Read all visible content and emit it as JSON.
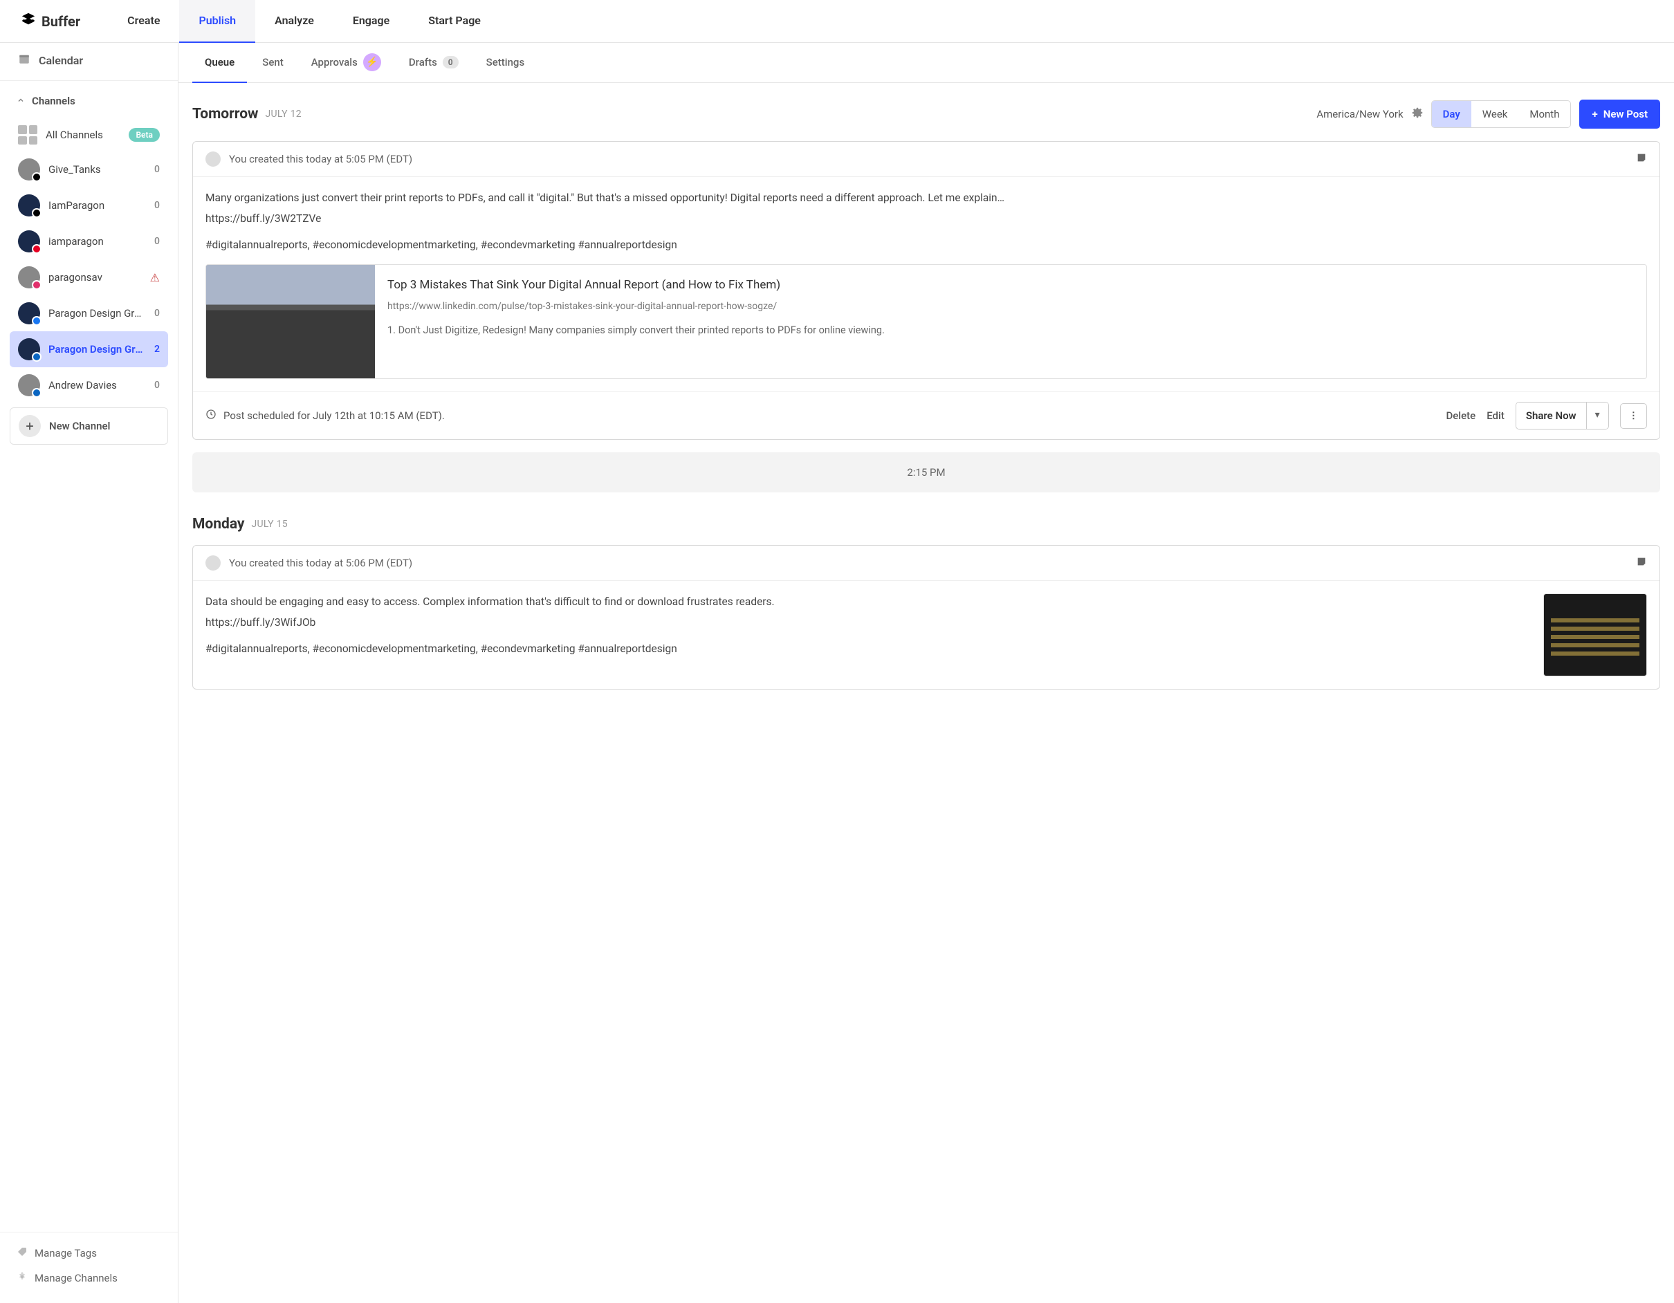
{
  "brand": "Buffer",
  "top_nav": [
    "Create",
    "Publish",
    "Analyze",
    "Engage",
    "Start Page"
  ],
  "top_nav_active": 1,
  "sidebar": {
    "calendar": "Calendar",
    "channels_header": "Channels",
    "all_channels": "All Channels",
    "all_badge": "Beta",
    "new_channel": "New Channel",
    "items": [
      {
        "name": "Give_Tanks",
        "count": "0",
        "net": "x",
        "avatar": "gray"
      },
      {
        "name": "IamParagon",
        "count": "0",
        "net": "x",
        "avatar": "dark"
      },
      {
        "name": "iamparagon",
        "count": "0",
        "net": "pin",
        "avatar": "dark"
      },
      {
        "name": "paragonsav",
        "warn": true,
        "net": "ig",
        "avatar": "gray"
      },
      {
        "name": "Paragon Design Gro…",
        "count": "0",
        "net": "fb",
        "avatar": "dark"
      },
      {
        "name": "Paragon Design Gro…",
        "count": "2",
        "net": "li",
        "avatar": "dark",
        "active": true
      },
      {
        "name": "Andrew Davies",
        "count": "0",
        "net": "li",
        "avatar": "gray"
      }
    ],
    "footer": {
      "tags": "Manage Tags",
      "channels": "Manage Channels"
    }
  },
  "sub_tabs": {
    "queue": "Queue",
    "sent": "Sent",
    "approvals": "Approvals",
    "drafts": "Drafts",
    "drafts_count": "0",
    "settings": "Settings"
  },
  "header": {
    "tz": "America/New York",
    "seg": [
      "Day",
      "Week",
      "Month"
    ],
    "seg_active": 0,
    "new_post": "New Post"
  },
  "days": [
    {
      "label": "Tomorrow",
      "date": "JULY 12",
      "posts": [
        {
          "created": "You created this today at 5:05 PM (EDT)",
          "text1": "Many organizations just convert their print reports to PDFs, and call it \"digital.\" But that's a missed opportunity!  Digital reports need a different approach. Let me explain…",
          "text2": "https://buff.ly/3W2TZVe",
          "hashtags": "#digitalannualreports, #economicdevelopmentmarketing, #econdevmarketing #annualreportdesign",
          "link": {
            "title": "Top 3 Mistakes That Sink Your Digital Annual Report (and How to Fix Them)",
            "url": "https://www.linkedin.com/pulse/top-3-mistakes-sink-your-digital-annual-report-how-sogze/",
            "desc": "1. Don't Just Digitize, Redesign! Many companies simply convert their printed reports to PDFs for online viewing."
          },
          "schedule": "Post scheduled for July 12th at 10:15 AM (EDT).",
          "actions": {
            "delete": "Delete",
            "edit": "Edit",
            "share": "Share Now"
          }
        }
      ],
      "empty_slot": "2:15 PM"
    },
    {
      "label": "Monday",
      "date": "JULY 15",
      "posts": [
        {
          "created": "You created this today at 5:06 PM (EDT)",
          "text1": "Data should be engaging and easy to access. Complex information that's difficult to find or download frustrates readers.",
          "text2": "https://buff.ly/3WifJOb",
          "hashtags": "#digitalannualreports, #economicdevelopmentmarketing, #econdevmarketing #annualreportdesign"
        }
      ]
    }
  ]
}
